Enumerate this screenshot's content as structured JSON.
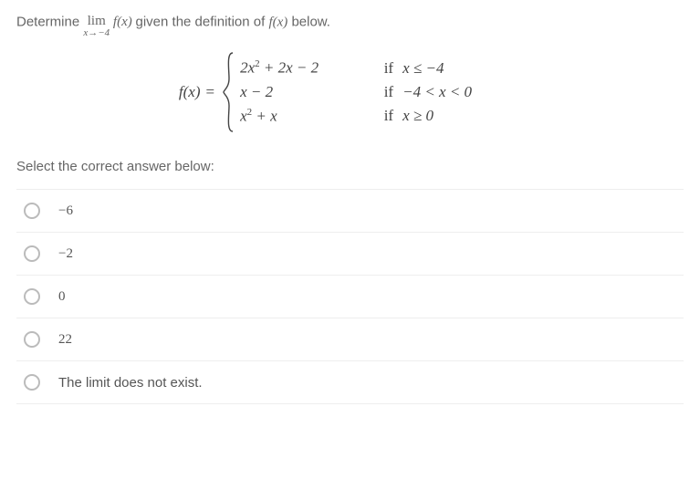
{
  "question": {
    "prefix": "Determine ",
    "lim_top": "lim",
    "lim_bot": "x→−4",
    "func": " f(x) ",
    "suffix": "given the definition of ",
    "func2": "f(x)",
    "suffix2": " below."
  },
  "piecewise": {
    "lhs": "f(x)",
    "eq": "=",
    "rows": [
      {
        "expr_html": "2x<span class='sup'>2</span> + 2x − 2",
        "if": "if",
        "cond_html": "x ≤ −4"
      },
      {
        "expr_html": "x − 2",
        "if": "if",
        "cond_html": "−4 < x < 0"
      },
      {
        "expr_html": "x<span class='sup'>2</span> + x",
        "if": "if",
        "cond_html": "x ≥ 0"
      }
    ]
  },
  "select_prompt": "Select the correct answer below:",
  "options": [
    {
      "label": "−6",
      "serif": true
    },
    {
      "label": "−2",
      "serif": true
    },
    {
      "label": "0",
      "serif": true
    },
    {
      "label": "22",
      "serif": true
    },
    {
      "label": "The limit does not exist.",
      "serif": false
    }
  ]
}
